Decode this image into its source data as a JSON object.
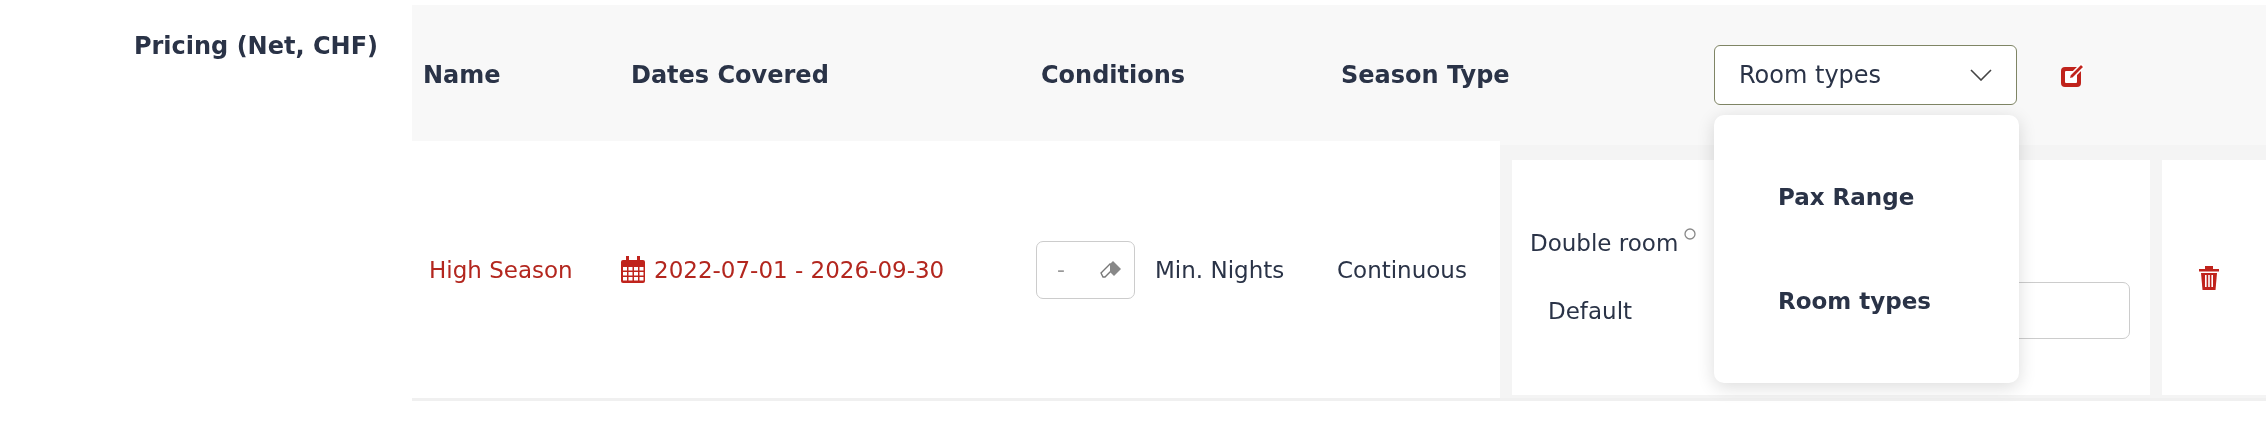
{
  "section_label": "Pricing (Net, CHF)",
  "columns": [
    "Name",
    "Dates Covered",
    "Conditions",
    "Season Type"
  ],
  "room_selector": {
    "value": "Room types",
    "expanded": true,
    "options": [
      {
        "label": "Pax Range"
      },
      {
        "label": "Room types"
      }
    ]
  },
  "rows": [
    {
      "name": "High Season",
      "dates": "2022-07-01 - 2026-09-30",
      "min_nights_placeholder": "-",
      "min_nights_label": "Min. Nights",
      "season_type": "Continuous",
      "rooms": [
        {
          "name": "Double room",
          "rate_label": "Default"
        }
      ]
    }
  ]
}
